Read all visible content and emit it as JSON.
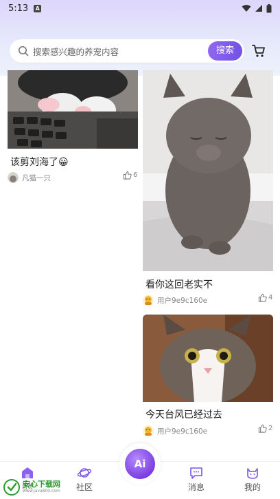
{
  "status_bar": {
    "time": "5:13",
    "notification_badge": "A"
  },
  "search": {
    "placeholder": "搜索感兴趣的养宠内容",
    "button_label": "搜索"
  },
  "feed": {
    "posts": [
      {
        "title": "该剪刘海了😀",
        "author": "凡猫一只",
        "likes": "6"
      },
      {
        "title": "看你这回老实不",
        "author": "用户9e9c160e",
        "likes": "4"
      },
      {
        "title": "今天台风已经过去",
        "author": "用户9e9c160e",
        "likes": "2"
      }
    ]
  },
  "nav": {
    "home_label": "首页",
    "community_label": "社区",
    "ai_label": "Ai",
    "messages_label": "消息",
    "mine_label": "我的"
  },
  "watermark": {
    "title": "安心下载网",
    "url": "www.java800.com"
  },
  "colors": {
    "accent": "#7b55e8",
    "background": "#ffffff"
  }
}
